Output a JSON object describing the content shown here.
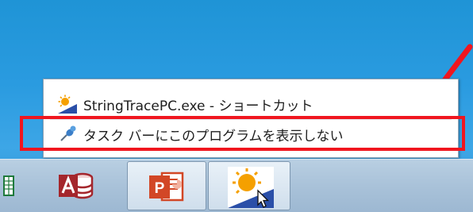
{
  "jump_list": {
    "items": [
      {
        "label": "StringTracePC.exe - ショートカット",
        "icon": "stringtrace-app-icon"
      },
      {
        "label": "タスク バーにこのプログラムを表示しない",
        "icon": "unpin-icon"
      }
    ],
    "highlighted_index": 1
  },
  "annotation": {
    "highlight_color": "#f0161f",
    "arrow_color": "#f0161f"
  },
  "taskbar": {
    "buttons": [
      {
        "name": "excel",
        "icon": "excel-icon"
      },
      {
        "name": "access",
        "icon": "access-icon"
      },
      {
        "name": "powerpoint",
        "icon": "powerpoint-icon",
        "icon_letter": "P"
      },
      {
        "name": "stringtracepc",
        "icon": "stringtrace-app-icon",
        "active": true
      }
    ]
  },
  "colors": {
    "desktop": "#2a9be0",
    "taskbar": "#a9c2d9"
  }
}
